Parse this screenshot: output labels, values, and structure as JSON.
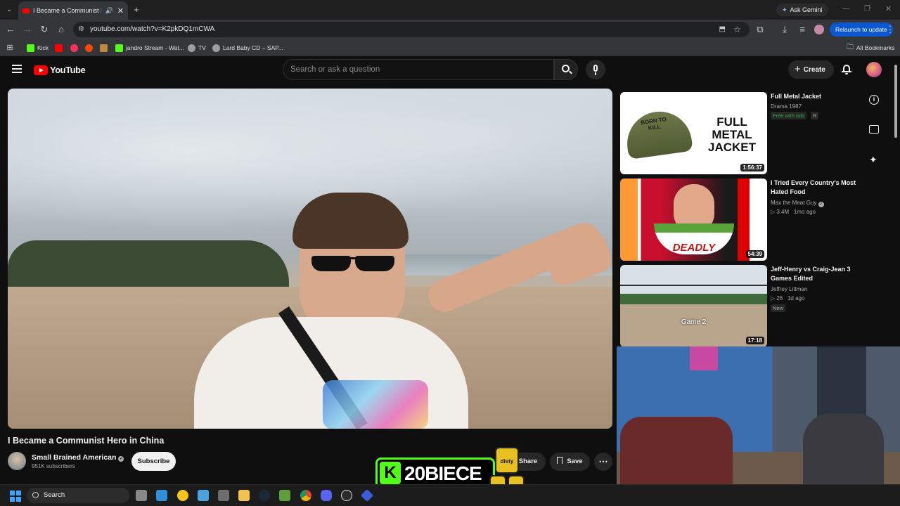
{
  "browser": {
    "tab_title": "I Became a Communist Her",
    "url": "youtube.com/watch?v=K2pkDQ1mCWA",
    "ask_gemini": "Ask Gemini",
    "relaunch": "Relaunch to update",
    "bookmarks": [
      {
        "label": "Kick",
        "color": "#53fc18"
      },
      {
        "label": "",
        "color": "#ff0000"
      },
      {
        "label": "",
        "color": "#ff2e5f"
      },
      {
        "label": "",
        "color": "#ff4500"
      },
      {
        "label": "",
        "color": "#c0873f"
      },
      {
        "label": "jandro Stream - Wat...",
        "color": "#53fc18"
      },
      {
        "label": "TV",
        "color": "#9e9e9e"
      },
      {
        "label": "Lard Baby CD – SAP...",
        "color": "#9e9e9e"
      }
    ],
    "all_bookmarks": "All Bookmarks"
  },
  "youtube": {
    "logo_text": "YouTube",
    "search_placeholder": "Search or ask a question",
    "create_label": "Create"
  },
  "video": {
    "title": "I Became a Communist Hero in China",
    "channel": "Small Brained American",
    "subscribers": "951K subscribers",
    "subscribe_label": "Subscribe",
    "share_label": "Share",
    "save_label": "Save"
  },
  "sidebar": [
    {
      "title": "Full Metal Jacket",
      "meta1": "Drama 1987",
      "badge1": "Free with ads",
      "badge2": "R",
      "duration": "1:56:37",
      "thumb_text": "FULL METAL JACKET",
      "helmet_text": "BORN TO KILL"
    },
    {
      "title": "I Tried Every Country's Most Hated Food",
      "channel": "Max the Meat Guy",
      "views": "3.4M",
      "age": "1mo ago",
      "duration": "54:39",
      "thumb_text": "DEADLY"
    },
    {
      "title": "Jeff-Henry vs Craig-Jean 3 Games Edited",
      "channel": "Jeffrey Littman",
      "views": "26",
      "age": "1d ago",
      "badge": "New",
      "duration": "17:18",
      "thumb_text": "Game 2"
    }
  ],
  "overlay": {
    "kick_text": "20BIECE",
    "kick_letter": "K",
    "can_label": "disty"
  },
  "taskbar": {
    "search_label": "Search"
  },
  "colors": {
    "kick_green": "#53fc18",
    "youtube_red": "#ff0000",
    "relaunch_blue": "#0b57d0"
  }
}
